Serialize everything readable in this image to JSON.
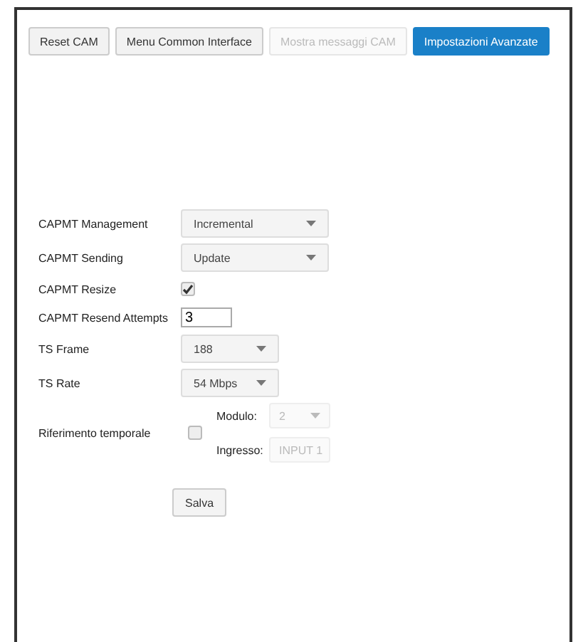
{
  "tabs": [
    {
      "label": "Reset CAM",
      "selected": false,
      "disabled": false
    },
    {
      "label": "Menu Common Interface",
      "selected": false,
      "disabled": false
    },
    {
      "label": "Mostra messaggi CAM",
      "selected": false,
      "disabled": true
    },
    {
      "label": "Impostazioni Avanzate",
      "selected": true,
      "disabled": false
    }
  ],
  "form": {
    "rows": [
      {
        "kind": "select",
        "label": "CAPMT Management",
        "value": "Incremental"
      },
      {
        "kind": "select",
        "label": "CAPMT Sending",
        "value": "Update"
      },
      {
        "kind": "checkbox",
        "label": "CAPMT Resize",
        "checked": true
      },
      {
        "kind": "text",
        "label": "CAPMT Resend Attempts",
        "value": "3"
      },
      {
        "kind": "compact",
        "label": "TS Frame",
        "value": "188"
      },
      {
        "kind": "compact",
        "label": "TS Rate",
        "value": "54 Mbps"
      },
      {
        "kind": "group",
        "label": "Riferimento temporale",
        "checked": false,
        "fields": [
          {
            "label": "Modulo:",
            "value": "2",
            "disabled": true
          },
          {
            "label": "Ingresso:",
            "value": "INPUT 1",
            "disabled": true
          }
        ]
      }
    ]
  },
  "save_button": "Salva"
}
